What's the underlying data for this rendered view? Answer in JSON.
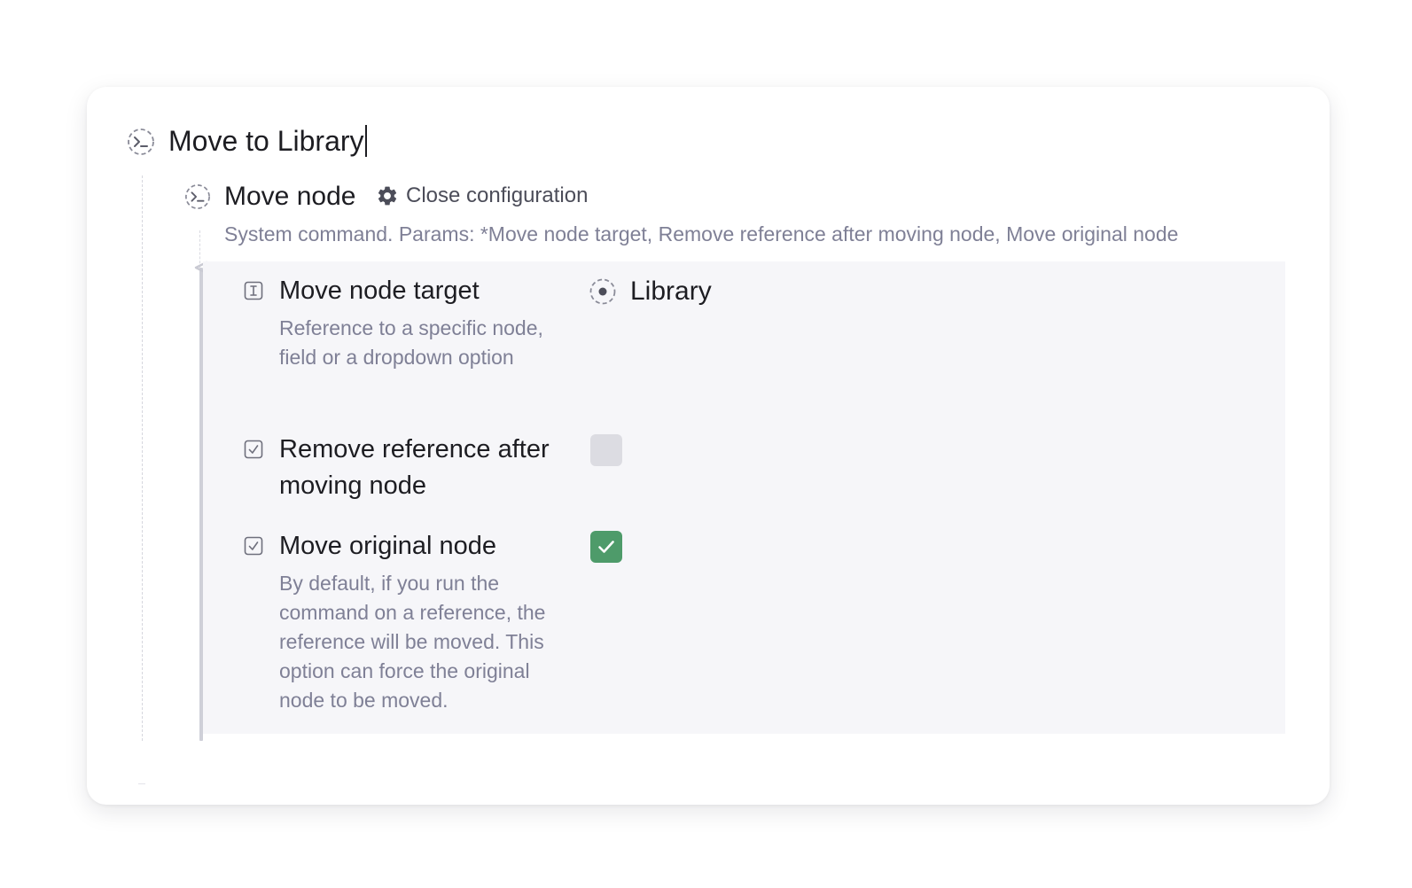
{
  "command": {
    "title": "Move to Library",
    "title_icon": "command-icon"
  },
  "subcommand": {
    "title": "Move node",
    "icon": "command-icon",
    "config_button": {
      "label": "Close configuration",
      "icon": "gear-icon"
    },
    "description": "System command. Params: *Move node target, Remove reference after moving node, Move original node"
  },
  "params": {
    "move_node_target": {
      "icon": "text-field-icon",
      "label": "Move node target",
      "description": "Reference to a specific node, field or a dropdown option",
      "value_icon": "node-reference-icon",
      "value": "Library"
    },
    "remove_reference": {
      "icon": "checkbox-field-icon",
      "label": "Remove reference after moving node",
      "checked": false
    },
    "move_original": {
      "icon": "checkbox-field-icon",
      "label": "Move original node",
      "description": "By default, if you run the command on a reference, the reference will be moved. This option can force the original node to be moved.",
      "checked": true
    }
  },
  "colors": {
    "checkbox_checked": "#4e9b6a",
    "checkbox_unchecked": "#dcdce2",
    "panel_bg": "#f6f6f9",
    "muted_text": "#7f8096"
  }
}
